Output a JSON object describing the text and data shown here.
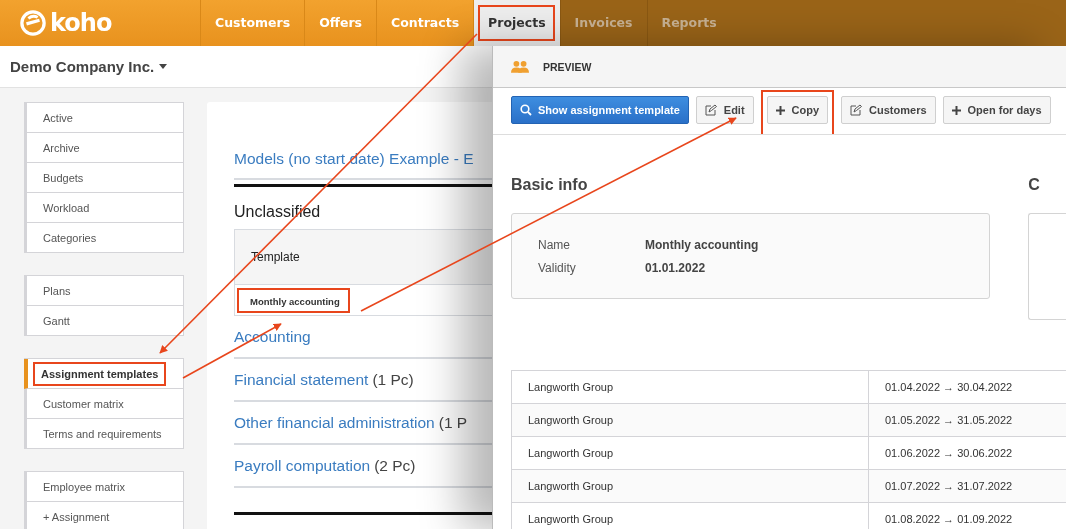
{
  "header": {
    "logo": "koho",
    "tabs": [
      {
        "label": "Customers",
        "selected": false,
        "dimmed": false,
        "highlighted": false
      },
      {
        "label": "Offers",
        "selected": false,
        "dimmed": false,
        "highlighted": false
      },
      {
        "label": "Contracts",
        "selected": false,
        "dimmed": false,
        "highlighted": false
      },
      {
        "label": "Projects",
        "selected": true,
        "dimmed": false,
        "highlighted": true
      },
      {
        "label": "Invoices",
        "selected": false,
        "dimmed": true,
        "highlighted": false
      },
      {
        "label": "Reports",
        "selected": false,
        "dimmed": true,
        "highlighted": false
      }
    ]
  },
  "company": {
    "name": "Demo Company Inc."
  },
  "sidebar": {
    "groups": [
      {
        "items": [
          {
            "label": "Active",
            "selected": false,
            "highlighted": false
          },
          {
            "label": "Archive",
            "selected": false,
            "highlighted": false
          },
          {
            "label": "Budgets",
            "selected": false,
            "highlighted": false
          },
          {
            "label": "Workload",
            "selected": false,
            "highlighted": false
          },
          {
            "label": "Categories",
            "selected": false,
            "highlighted": false
          }
        ]
      },
      {
        "items": [
          {
            "label": "Plans",
            "selected": false,
            "highlighted": false
          },
          {
            "label": "Gantt",
            "selected": false,
            "highlighted": false
          }
        ]
      },
      {
        "items": [
          {
            "label": "Assignment templates",
            "selected": true,
            "highlighted": true
          },
          {
            "label": "Customer matrix",
            "selected": false,
            "highlighted": false
          },
          {
            "label": "Terms and requirements",
            "selected": false,
            "highlighted": false
          }
        ]
      },
      {
        "items": [
          {
            "label": "Employee matrix",
            "selected": false,
            "highlighted": false
          },
          {
            "label": "+ Assignment",
            "selected": false,
            "highlighted": false
          }
        ]
      }
    ]
  },
  "main": {
    "title_link": "Models (no start date) Example - E",
    "section": "Unclassified",
    "table": {
      "columns": [
        "Template"
      ],
      "rows": [
        {
          "name": "Monthly accounting",
          "highlighted": true
        }
      ]
    },
    "categories": [
      {
        "name": "Accounting"
      },
      {
        "name": "Financial statement",
        "count": "(1 Pc)"
      },
      {
        "name": "Other financial administration",
        "count": "(1 P"
      },
      {
        "name": "Payroll computation",
        "count": "(2 Pc)"
      }
    ]
  },
  "preview": {
    "title": "PREVIEW",
    "buttons": [
      {
        "label": "Show assignment template",
        "kind": "primary",
        "highlighted": false
      },
      {
        "label": "Edit",
        "kind": "edit",
        "highlighted": false
      },
      {
        "label": "Copy",
        "kind": "add",
        "highlighted": true
      },
      {
        "label": "Customers",
        "kind": "edit",
        "highlighted": false
      },
      {
        "label": "Open for days",
        "kind": "add",
        "highlighted": false
      }
    ],
    "basic_info": {
      "heading": "Basic info",
      "fields": [
        {
          "label": "Name",
          "value": "Monthly accounting"
        },
        {
          "label": "Validity",
          "value": "01.01.2022"
        }
      ]
    },
    "side_heading": "C",
    "periods": [
      {
        "customer": "Langworth Group",
        "range": "01.04.2022 → 30.04.2022"
      },
      {
        "customer": "Langworth Group",
        "range": "01.05.2022 → 31.05.2022"
      },
      {
        "customer": "Langworth Group",
        "range": "01.06.2022 → 30.06.2022"
      },
      {
        "customer": "Langworth Group",
        "range": "01.07.2022 → 31.07.2022"
      },
      {
        "customer": "Langworth Group",
        "range": "01.08.2022 → 01.09.2022"
      }
    ]
  }
}
